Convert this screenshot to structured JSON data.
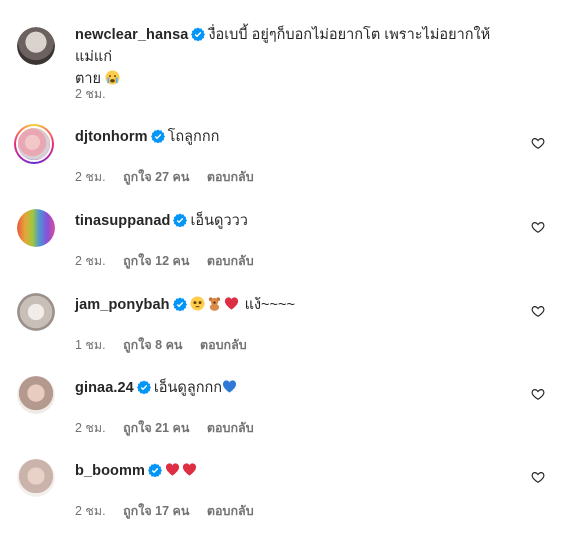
{
  "comments": [
    {
      "username": "newclear_hansa",
      "text_line1": "งื่อเบบี้ อยู่ๆก็บอกไม่อยากโต เพราะไม่อยากให้แม่แก่",
      "text_line2": "ตาย",
      "text_emoji": "crying-face-emoji",
      "time": "2 ชม.",
      "likes": "",
      "reply": ""
    },
    {
      "username": "djtonhorm",
      "text": "โถลูกกก",
      "time": "2 ชม.",
      "likes": "ถูกใจ 27 คน",
      "reply": "ตอบกลับ"
    },
    {
      "username": "tinasuppanad",
      "text": "เอ็นดูววว",
      "time": "2 ชม.",
      "likes": "ถูกใจ 12 คน",
      "reply": "ตอบกลับ"
    },
    {
      "username": "jam_ponybah",
      "text": "แง้~~~~",
      "emojis": [
        "pleading-face-emoji",
        "teddy-bear-emoji",
        "red-heart-emoji"
      ],
      "time": "1 ชม.",
      "likes": "ถูกใจ 8 คน",
      "reply": "ตอบกลับ"
    },
    {
      "username": "ginaa.24",
      "text": "เอ็นดูลูกกก",
      "emojis": [
        "blue-heart-emoji"
      ],
      "time": "2 ชม.",
      "likes": "ถูกใจ 21 คน",
      "reply": "ตอบกลับ"
    },
    {
      "username": "b_boomm",
      "text": "",
      "emojis": [
        "red-heart-emoji",
        "red-heart-emoji"
      ],
      "time": "2 ชม.",
      "likes": "ถูกใจ 17 คน",
      "reply": "ตอบกลับ"
    }
  ],
  "colors": {
    "verified": "#0095f6",
    "muted_text": "#737373",
    "primary_text": "#262626"
  }
}
